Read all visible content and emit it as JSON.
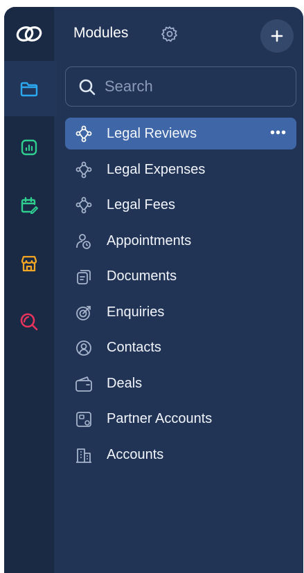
{
  "header": {
    "title": "Modules"
  },
  "search": {
    "placeholder": "Search"
  },
  "active_more": "•••",
  "modules": [
    {
      "label": "Legal Reviews",
      "icon": "workflow-icon"
    },
    {
      "label": "Legal Expenses",
      "icon": "workflow-icon"
    },
    {
      "label": "Legal Fees",
      "icon": "workflow-icon"
    },
    {
      "label": "Appointments",
      "icon": "appointment-icon"
    },
    {
      "label": "Documents",
      "icon": "documents-icon"
    },
    {
      "label": "Enquiries",
      "icon": "enquiry-icon"
    },
    {
      "label": "Contacts",
      "icon": "contact-icon"
    },
    {
      "label": "Deals",
      "icon": "wallet-icon"
    },
    {
      "label": "Partner Accounts",
      "icon": "partner-icon"
    },
    {
      "label": "Accounts",
      "icon": "building-icon"
    }
  ],
  "colors": {
    "rail_bg": "#1a2944",
    "panel_bg": "#213456",
    "active_item": "#3f66a6",
    "folder_icon": "#2aa9f0",
    "chart_icon": "#2ecf8f",
    "calendar_icon": "#2ecf8f",
    "store_icon": "#f5a623",
    "search_icon": "#e8345c"
  }
}
